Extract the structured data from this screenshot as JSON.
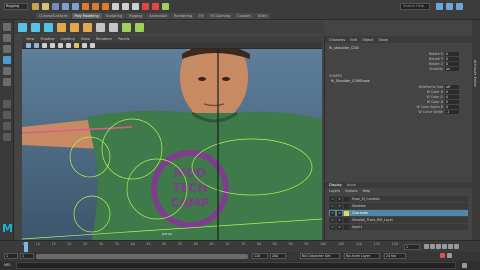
{
  "status_line": {
    "menu_set": "Rigging",
    "search_placeholder": "Search Help",
    "shelf_tabs": [
      "Curves/Surfaces",
      "Poly Modeling",
      "Sculpting",
      "Rigging",
      "Animation",
      "Rendering",
      "FX",
      "FX Caching",
      "Custom",
      "XGen"
    ],
    "active_shelf": "Poly Modeling"
  },
  "panel_menu": [
    "View",
    "Shading",
    "Lighting",
    "Show",
    "Renderer",
    "Panels"
  ],
  "viewport": {
    "camera": "persp",
    "shirt_text": [
      "MOO",
      "TECH",
      "CAMP"
    ]
  },
  "channel_box": {
    "tabs": [
      "Channels",
      "Edit",
      "Object",
      "Show"
    ],
    "object_name": "fk_shoulder_CON",
    "attributes": [
      {
        "label": "Rotate X",
        "value": "0"
      },
      {
        "label": "Rotate Y",
        "value": "0"
      },
      {
        "label": "Rotate Z",
        "value": "0"
      },
      {
        "label": "Visibility",
        "value": "on"
      }
    ],
    "shapes_header": "SHAPES",
    "shape_name": "fk_Shoulder_CONShape",
    "shape_attributes": [
      {
        "label": "Wireframe Sub",
        "value": "off"
      },
      {
        "label": "W Color R",
        "value": "0"
      },
      {
        "label": "W Color G",
        "value": "0"
      },
      {
        "label": "W Color B",
        "value": "0"
      },
      {
        "label": "W Color Alpha R",
        "value": "0"
      },
      {
        "label": "W Curve Width",
        "value": "-1"
      }
    ]
  },
  "layer_editor": {
    "tabs": [
      "Display",
      "Anim"
    ],
    "menu": [
      "Layers",
      "Options",
      "Help"
    ],
    "layers": [
      {
        "name": "Evan_M_Controls",
        "selected": false
      },
      {
        "name": "Skeleton",
        "selected": false
      },
      {
        "name": "Character",
        "selected": true
      },
      {
        "name": "Skeletal_Track_RM_Layer",
        "selected": false
      },
      {
        "name": "layer1",
        "selected": false
      }
    ]
  },
  "side_tab": "Attribute Editor",
  "time_slider": {
    "ticks": [
      "5",
      "10",
      "15",
      "20",
      "25",
      "30",
      "35",
      "40",
      "45",
      "50",
      "55",
      "60",
      "65",
      "70",
      "75",
      "80",
      "85",
      "90",
      "95",
      "100",
      "105",
      "110",
      "115",
      "120"
    ],
    "current_frame": "1"
  },
  "range_slider": {
    "start": "1",
    "range_start": "1",
    "range_end": "120",
    "end": "200",
    "character_set": "No Character Set",
    "anim_layer": "No Anim Layer",
    "fps": "24 fps"
  },
  "cmd_line": {
    "label": "MEL"
  },
  "colors": {
    "accent": "#19b5d9",
    "selection": "#5285a6",
    "shirt": "#3f7a4a",
    "control_curves": "#b8f05a",
    "arm_curve": "#e05a8a"
  }
}
